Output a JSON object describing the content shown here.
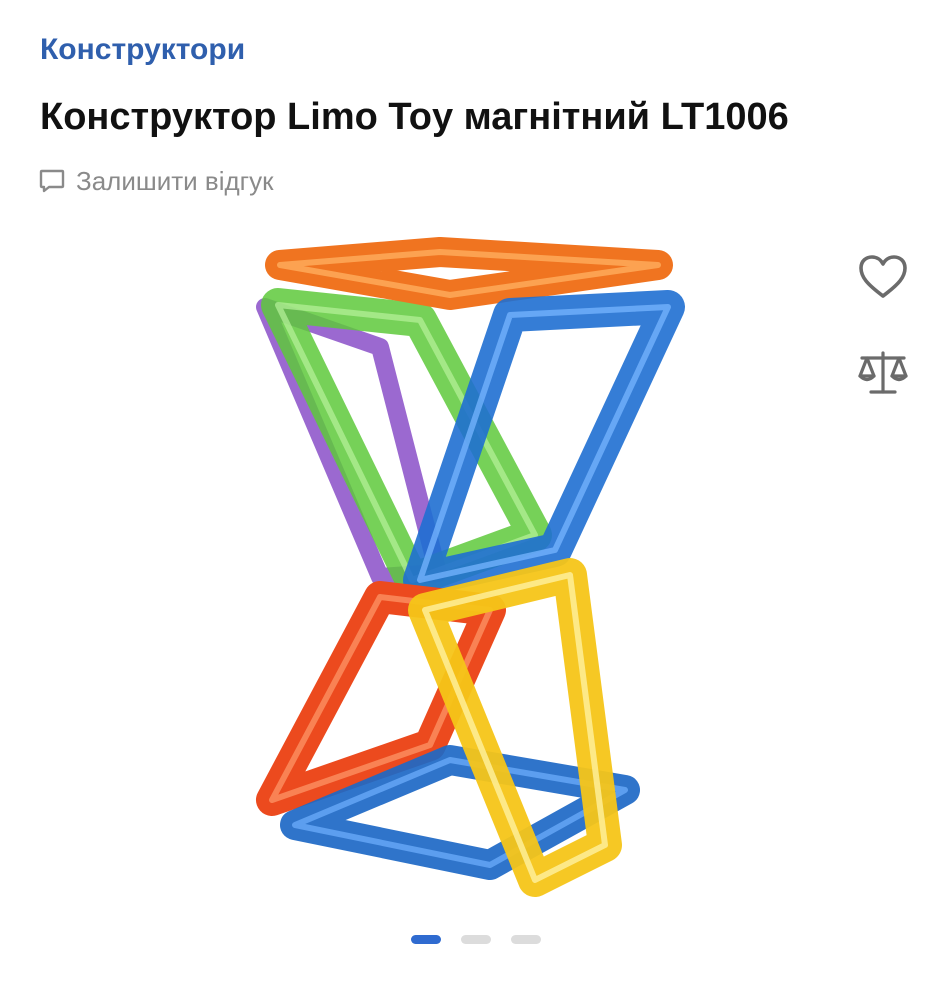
{
  "breadcrumb": {
    "label": "Конструктори"
  },
  "product": {
    "title": "Конструктор Limo Toy магнітний LT1006",
    "review_link": "Залишити відгук",
    "image_alt": "Магнітний конструктор Limo Toy LT1006"
  },
  "actions": {
    "favorite_icon": "heart-icon",
    "compare_icon": "scales-icon"
  },
  "gallery": {
    "slide_count": 3,
    "active_slide": 1
  },
  "colors": {
    "accent": "#2f5fad",
    "dot_active": "#2f6bd0",
    "dot_inactive": "#dcdcdc",
    "muted_text": "#8a8a8a",
    "icon_gray": "#6b6b6b"
  }
}
